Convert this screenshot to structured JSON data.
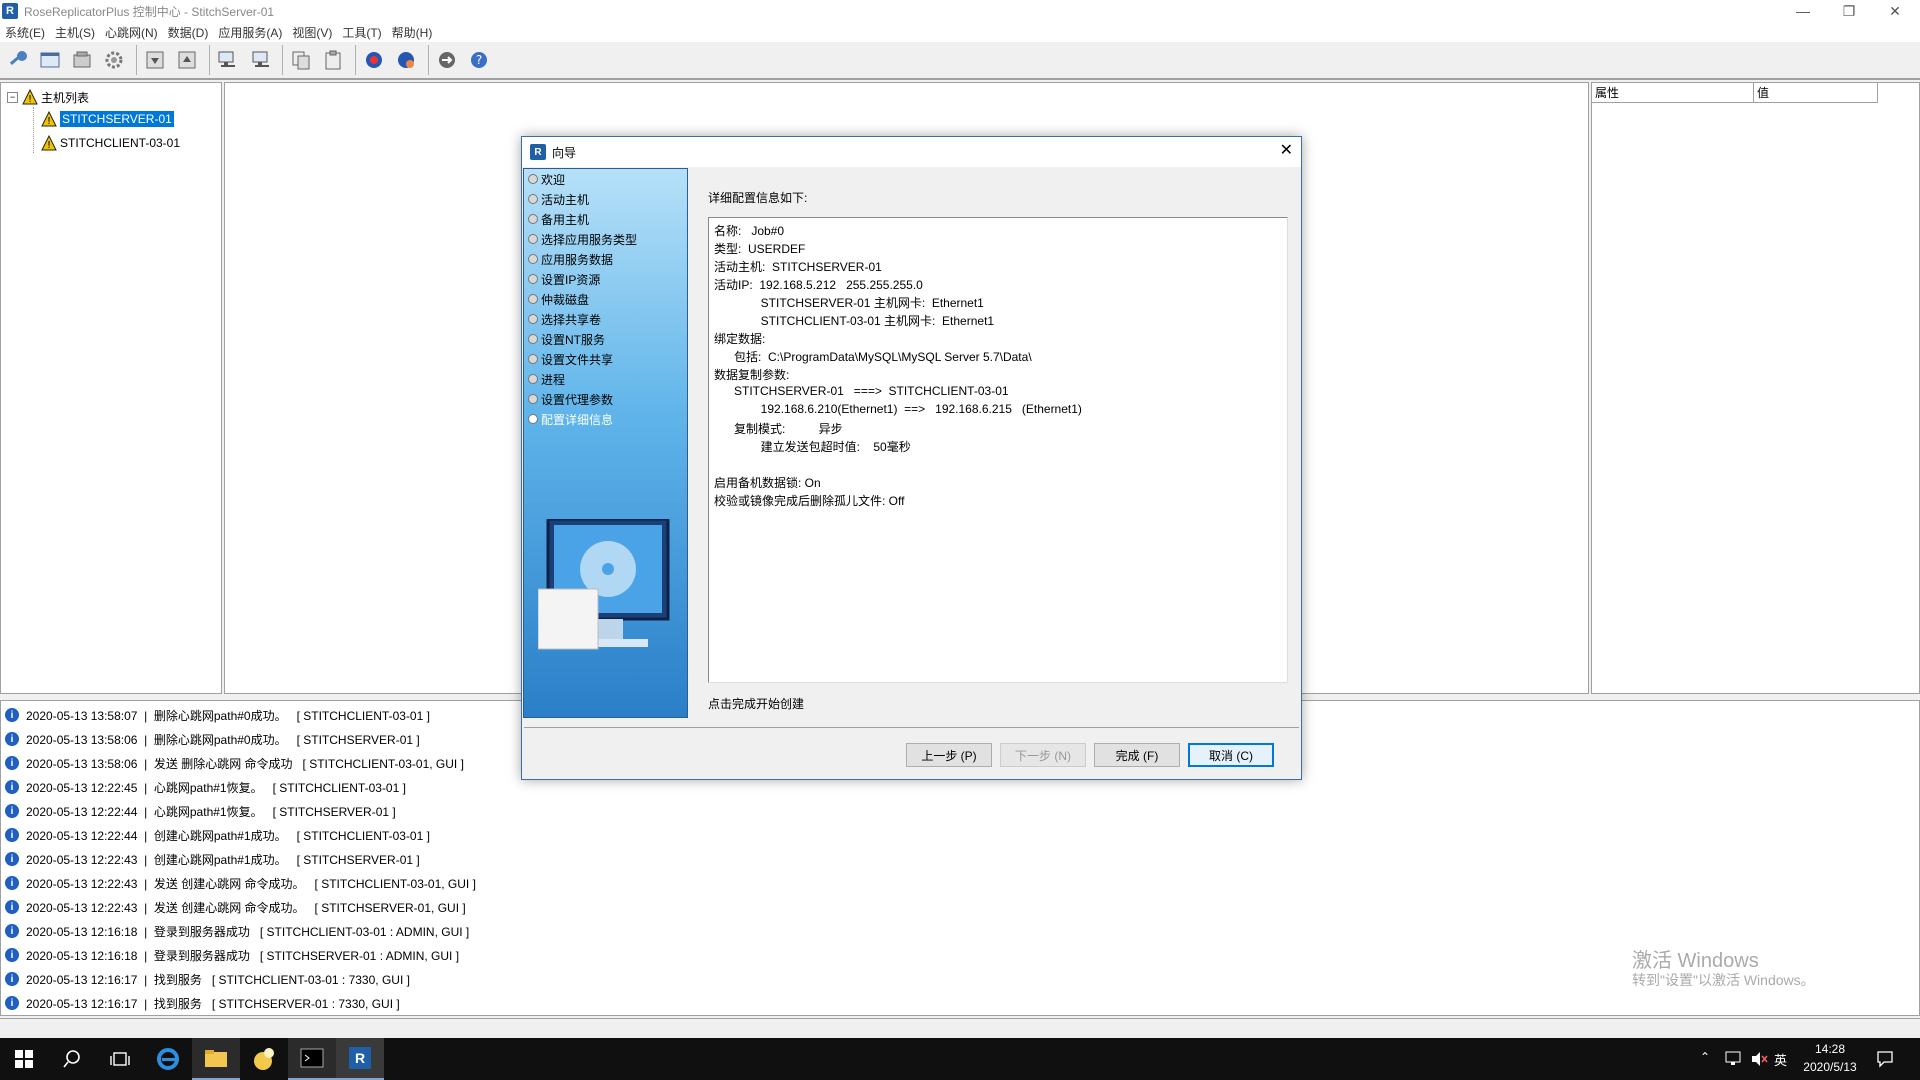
{
  "window": {
    "title": "RoseReplicatorPlus 控制中心   -   StitchServer-01"
  },
  "menu": [
    "系统(E)",
    "主机(S)",
    "心跳网(N)",
    "数据(D)",
    "应用服务(A)",
    "视图(V)",
    "工具(T)",
    "帮助(H)"
  ],
  "toolbar_icons": [
    "key-icon",
    "window-icon",
    "disk-icon",
    "gear-icon",
    "download-icon",
    "upload-icon",
    "network-icon",
    "network-out-icon",
    "copy-icon",
    "paste-icon",
    "globe-icon",
    "globe-settings-icon",
    "arrow-circle-icon",
    "help-icon"
  ],
  "tree": {
    "root": "主机列表",
    "items": [
      "STITCHSERVER-01",
      "STITCHCLIENT-03-01"
    ]
  },
  "properties": {
    "col1": "属性",
    "col2": "值"
  },
  "logs": [
    "2020-05-13 13:58:07  |  删除心跳网path#0成功。   [ STITCHCLIENT-03-01 ]",
    "2020-05-13 13:58:06  |  删除心跳网path#0成功。   [ STITCHSERVER-01 ]",
    "2020-05-13 13:58:06  |  发送 删除心跳网 命令成功   [ STITCHCLIENT-03-01, GUI ]",
    "2020-05-13 12:22:45  |  心跳网path#1恢复。   [ STITCHCLIENT-03-01 ]",
    "2020-05-13 12:22:44  |  心跳网path#1恢复。   [ STITCHSERVER-01 ]",
    "2020-05-13 12:22:44  |  创建心跳网path#1成功。   [ STITCHCLIENT-03-01 ]",
    "2020-05-13 12:22:43  |  创建心跳网path#1成功。   [ STITCHSERVER-01 ]",
    "2020-05-13 12:22:43  |  发送 创建心跳网 命令成功。   [ STITCHCLIENT-03-01, GUI ]",
    "2020-05-13 12:22:43  |  发送 创建心跳网 命令成功。   [ STITCHSERVER-01, GUI ]",
    "2020-05-13 12:16:18  |  登录到服务器成功   [ STITCHCLIENT-03-01 : ADMIN, GUI ]",
    "2020-05-13 12:16:18  |  登录到服务器成功   [ STITCHSERVER-01 : ADMIN, GUI ]",
    "2020-05-13 12:16:17  |  找到服务   [ STITCHCLIENT-03-01 : 7330, GUI ]",
    "2020-05-13 12:16:17  |  找到服务   [ STITCHSERVER-01 : 7330, GUI ]"
  ],
  "wizard": {
    "title": "向导",
    "steps": [
      "欢迎",
      "活动主机",
      "备用主机",
      "选择应用服务类型",
      "应用服务数据",
      "设置IP资源",
      "仲裁磁盘",
      "选择共享卷",
      "设置NT服务",
      "设置文件共享",
      "进程",
      "设置代理参数",
      "配置详细信息"
    ],
    "active_step": "配置详细信息",
    "heading": "详细配置信息如下:",
    "details": [
      "名称:   Job#0",
      "类型:  USERDEF",
      "活动主机:  STITCHSERVER-01",
      "活动IP:  192.168.5.212   255.255.255.0",
      "              STITCHSERVER-01 主机网卡:  Ethernet1",
      "              STITCHCLIENT-03-01 主机网卡:  Ethernet1",
      "绑定数据:",
      "      包括:  C:\\ProgramData\\MySQL\\MySQL Server 5.7\\Data\\",
      "数据复制参数:",
      "      STITCHSERVER-01   ===>  STITCHCLIENT-03-01",
      "              192.168.6.210(Ethernet1)  ==>   192.168.6.215   (Ethernet1)",
      "      复制模式:          异步",
      "              建立发送包超时值:    50毫秒",
      "",
      "启用备机数据锁: On",
      "校验或镜像完成后删除孤儿文件: Off"
    ],
    "footer_hint": "点击完成开始创建",
    "buttons": {
      "prev": "上一步 (P)",
      "next": "下一步 (N)",
      "finish": "完成 (F)",
      "cancel": "取消 (C)"
    }
  },
  "watermark": {
    "line1": "激活 Windows",
    "line2": "转到\"设置\"以激活 Windows。"
  },
  "taskbar": {
    "time": "14:28",
    "date": "2020/5/13",
    "ime": "英",
    "icons": [
      "windows-start-icon",
      "search-icon",
      "task-view-icon",
      "ie-icon",
      "folder-icon",
      "app-yellow-icon",
      "terminal-icon",
      "rose-replicator-icon"
    ]
  }
}
